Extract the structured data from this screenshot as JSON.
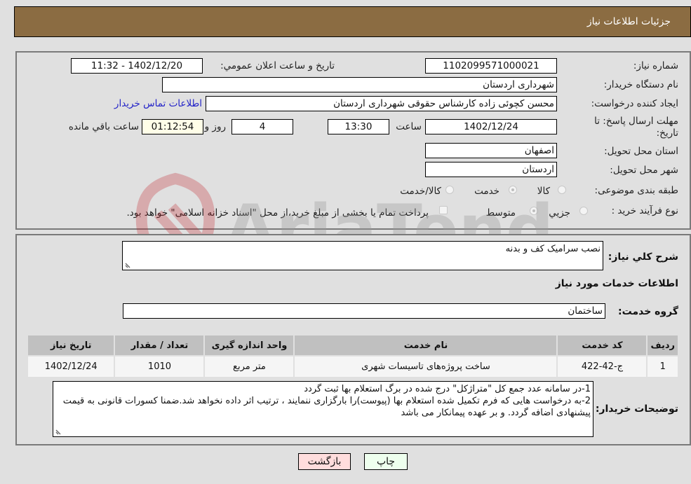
{
  "header": {
    "title": "جزئیات اطلاعات نیاز"
  },
  "form": {
    "need_number": {
      "label": "شماره نیاز:",
      "value": "1102099571000021"
    },
    "announce_datetime": {
      "label": "تاریخ و ساعت اعلان عمومي:",
      "value": "1402/12/20 - 11:32"
    },
    "buyer_org": {
      "label": "نام دستگاه خریدار:",
      "value": "شهرداری اردستان"
    },
    "requester": {
      "label": "ایجاد کننده درخواست:",
      "value": "محسن کچوئی زاده کارشناس حقوقی شهرداری اردستان"
    },
    "buyer_contact_link": "اطلاعات تماس خریدار",
    "deadline": {
      "label_line1": "مهلت ارسال پاسخ: تا",
      "label_line2": "تاریخ:",
      "date": "1402/12/24",
      "time_label": "ساعت",
      "time": "13:30",
      "days": "4",
      "days_label": "روز و",
      "remaining": "01:12:54",
      "remaining_label": "ساعت باقي مانده"
    },
    "province": {
      "label": "استان محل تحویل:",
      "value": "اصفهان"
    },
    "city": {
      "label": "شهر محل تحویل:",
      "value": "اردستان"
    },
    "category": {
      "label": "طبقه بندی موضوعی:",
      "options": [
        "کالا",
        "خدمت",
        "کالا/خدمت"
      ],
      "selected": "خدمت"
    },
    "purchase_process": {
      "label": "نوع فرآیند خرید :",
      "options": [
        "جزيي",
        "متوسط"
      ],
      "selected": "متوسط",
      "treasury_note": "پرداخت تمام یا بخشی از مبلغ خرید،از محل \"اسناد خزانه اسلامی\" خواهد بود."
    }
  },
  "details": {
    "general_desc_label": "شرح كلي نياز:",
    "general_desc": "نصب سرامیک کف و بدنه",
    "services_heading": "اطلاعات خدمات مورد نياز",
    "service_group_label": "گروه خدمت:",
    "service_group": "ساختمان",
    "table": {
      "headers": [
        "رديف",
        "کد خدمت",
        "نام خدمت",
        "واحد اندازه گیری",
        "تعداد / مقدار",
        "تاریخ نیاز"
      ],
      "rows": [
        [
          "1",
          "ج-42-422",
          "ساخت پروژه‌های تاسیسات شهری",
          "متر مربع",
          "1010",
          "1402/12/24"
        ]
      ]
    },
    "buyer_notes_label": "توضیحات خریدار:",
    "buyer_notes": [
      "1-در سامانه عدد جمع کل \"متراژکل\" درج شده در برگ استعلام بها  ثبت گردد",
      "2-به درخواست هایی که فرم تکمیل شده استعلام بها (پیوست)را بارگزاری ننمایند ، ترتیب اثر داده نخواهد شد.ضمنا کسورات قانونی به قیمت پیشنهادی اضافه گردد. و بر عهده پیمانکار می باشد"
    ]
  },
  "buttons": {
    "print": "چاپ",
    "back": "بازگشت"
  },
  "watermark": {
    "text": "AriaTender.neT"
  },
  "colors": {
    "header_bg": "#8b6c42",
    "print_bg": "#eeffee",
    "back_bg": "#ffdddd",
    "link": "#2323c8"
  }
}
